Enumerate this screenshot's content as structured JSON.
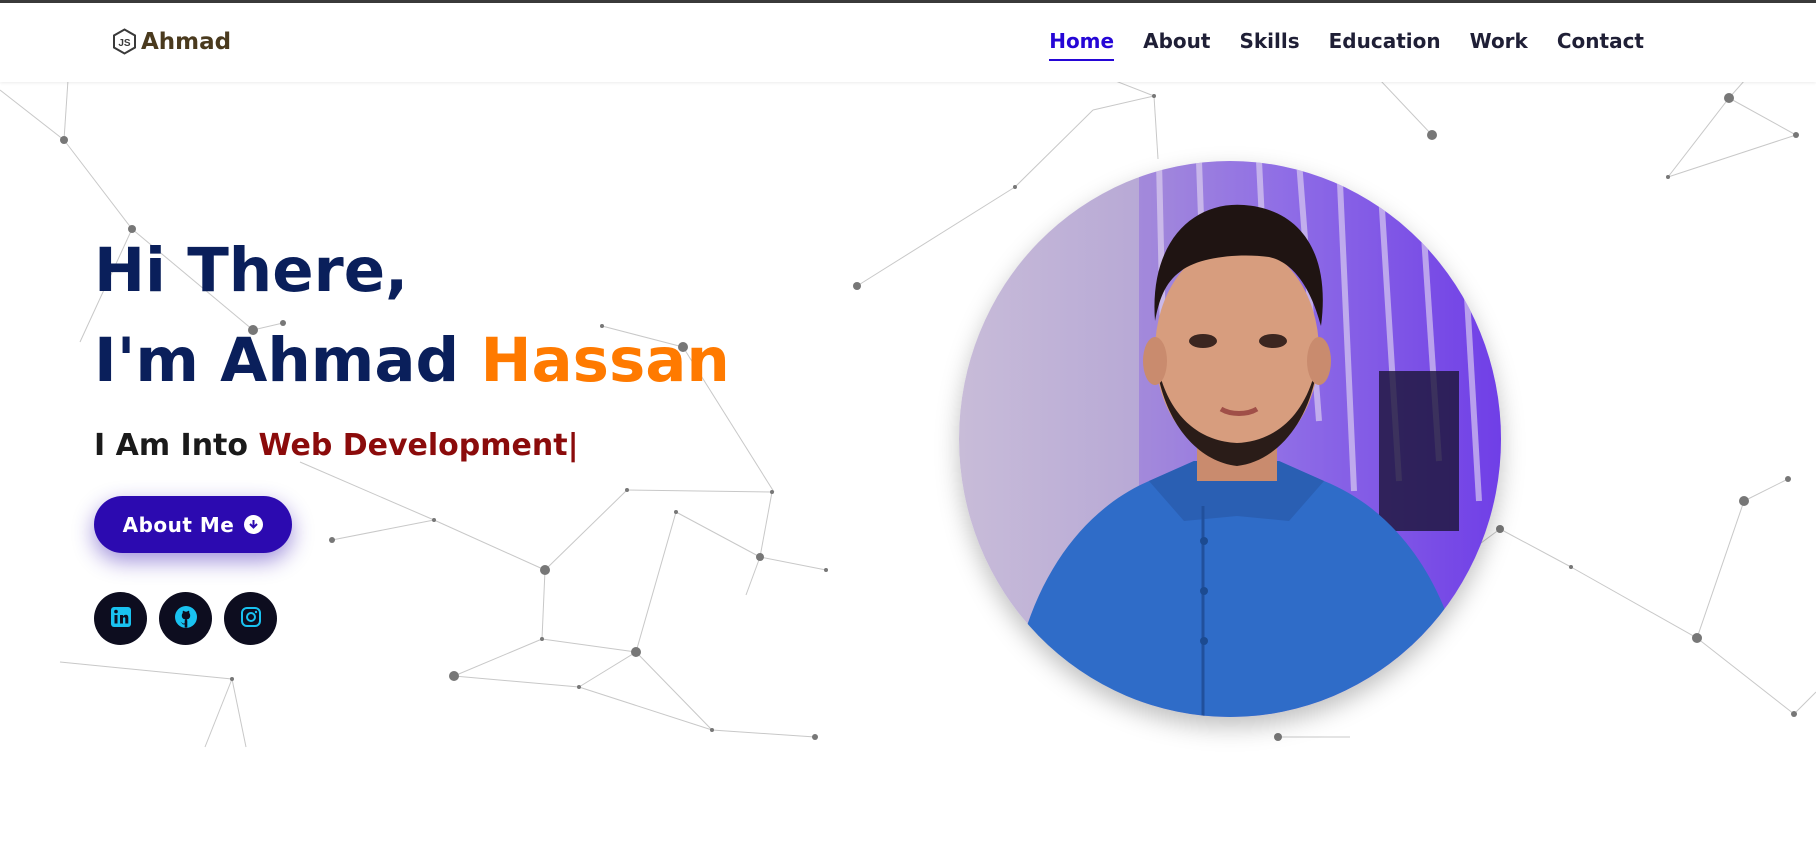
{
  "header": {
    "logo_text": "Ahmad",
    "logo_icon": "nodejs-icon",
    "nav": [
      {
        "label": "Home",
        "active": true
      },
      {
        "label": "About"
      },
      {
        "label": "Skills"
      },
      {
        "label": "Education"
      },
      {
        "label": "Work"
      },
      {
        "label": "Contact"
      }
    ]
  },
  "hero": {
    "line1": "Hi There,",
    "line2_prefix": "I'm Ahmad ",
    "line2_accent": "Hassan",
    "line3_prefix": "I Am Into ",
    "line3_typed": "Web Development",
    "cursor": "|",
    "button_label": "About Me",
    "button_icon": "arrow-down-circle-icon"
  },
  "socials": [
    {
      "name": "linkedin-icon"
    },
    {
      "name": "github-icon"
    },
    {
      "name": "instagram-icon"
    }
  ],
  "colors": {
    "accent": "#2506d6",
    "heading": "#0a1f5b",
    "highlight": "#ff7a00",
    "typed": "#8b0b0b",
    "button": "#2c0ab0",
    "social_icon": "#19c2f0"
  }
}
